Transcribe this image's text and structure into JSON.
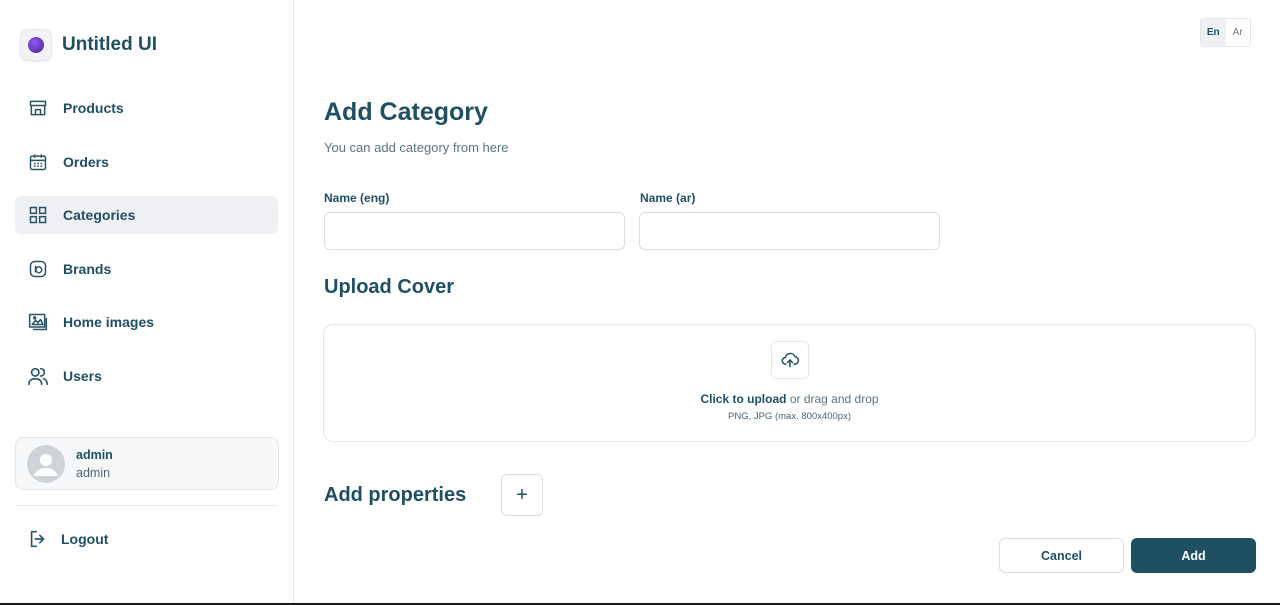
{
  "brand": {
    "name": "Untitled UI",
    "accent": "#1f4f63"
  },
  "sidebar": {
    "items": [
      {
        "label": "Products",
        "icon": "store-icon",
        "active": false
      },
      {
        "label": "Orders",
        "icon": "calendar-icon",
        "active": false
      },
      {
        "label": "Categories",
        "icon": "grid-icon",
        "active": true
      },
      {
        "label": "Brands",
        "icon": "brand-icon",
        "active": false
      },
      {
        "label": "Home images",
        "icon": "images-icon",
        "active": false
      },
      {
        "label": "Users",
        "icon": "users-icon",
        "active": false
      }
    ],
    "user": {
      "name": "admin",
      "role": "admin"
    },
    "logout_label": "Logout"
  },
  "language": {
    "en": "En",
    "ar": "Ar",
    "selected": "En"
  },
  "page": {
    "title": "Add Category",
    "subtitle": "You can add category from here"
  },
  "form": {
    "name_eng": {
      "label": "Name (eng)",
      "value": "",
      "placeholder": ""
    },
    "name_ar": {
      "label": "Name (ar)",
      "value": "",
      "placeholder": ""
    }
  },
  "upload": {
    "title": "Upload Cover",
    "cta": "Click to upload",
    "rest": "or drag and drop",
    "hint": "PNG, JPG (max. 800x400px)"
  },
  "properties": {
    "title": "Add properties",
    "add_symbol": "+"
  },
  "actions": {
    "cancel": "Cancel",
    "add": "Add"
  }
}
